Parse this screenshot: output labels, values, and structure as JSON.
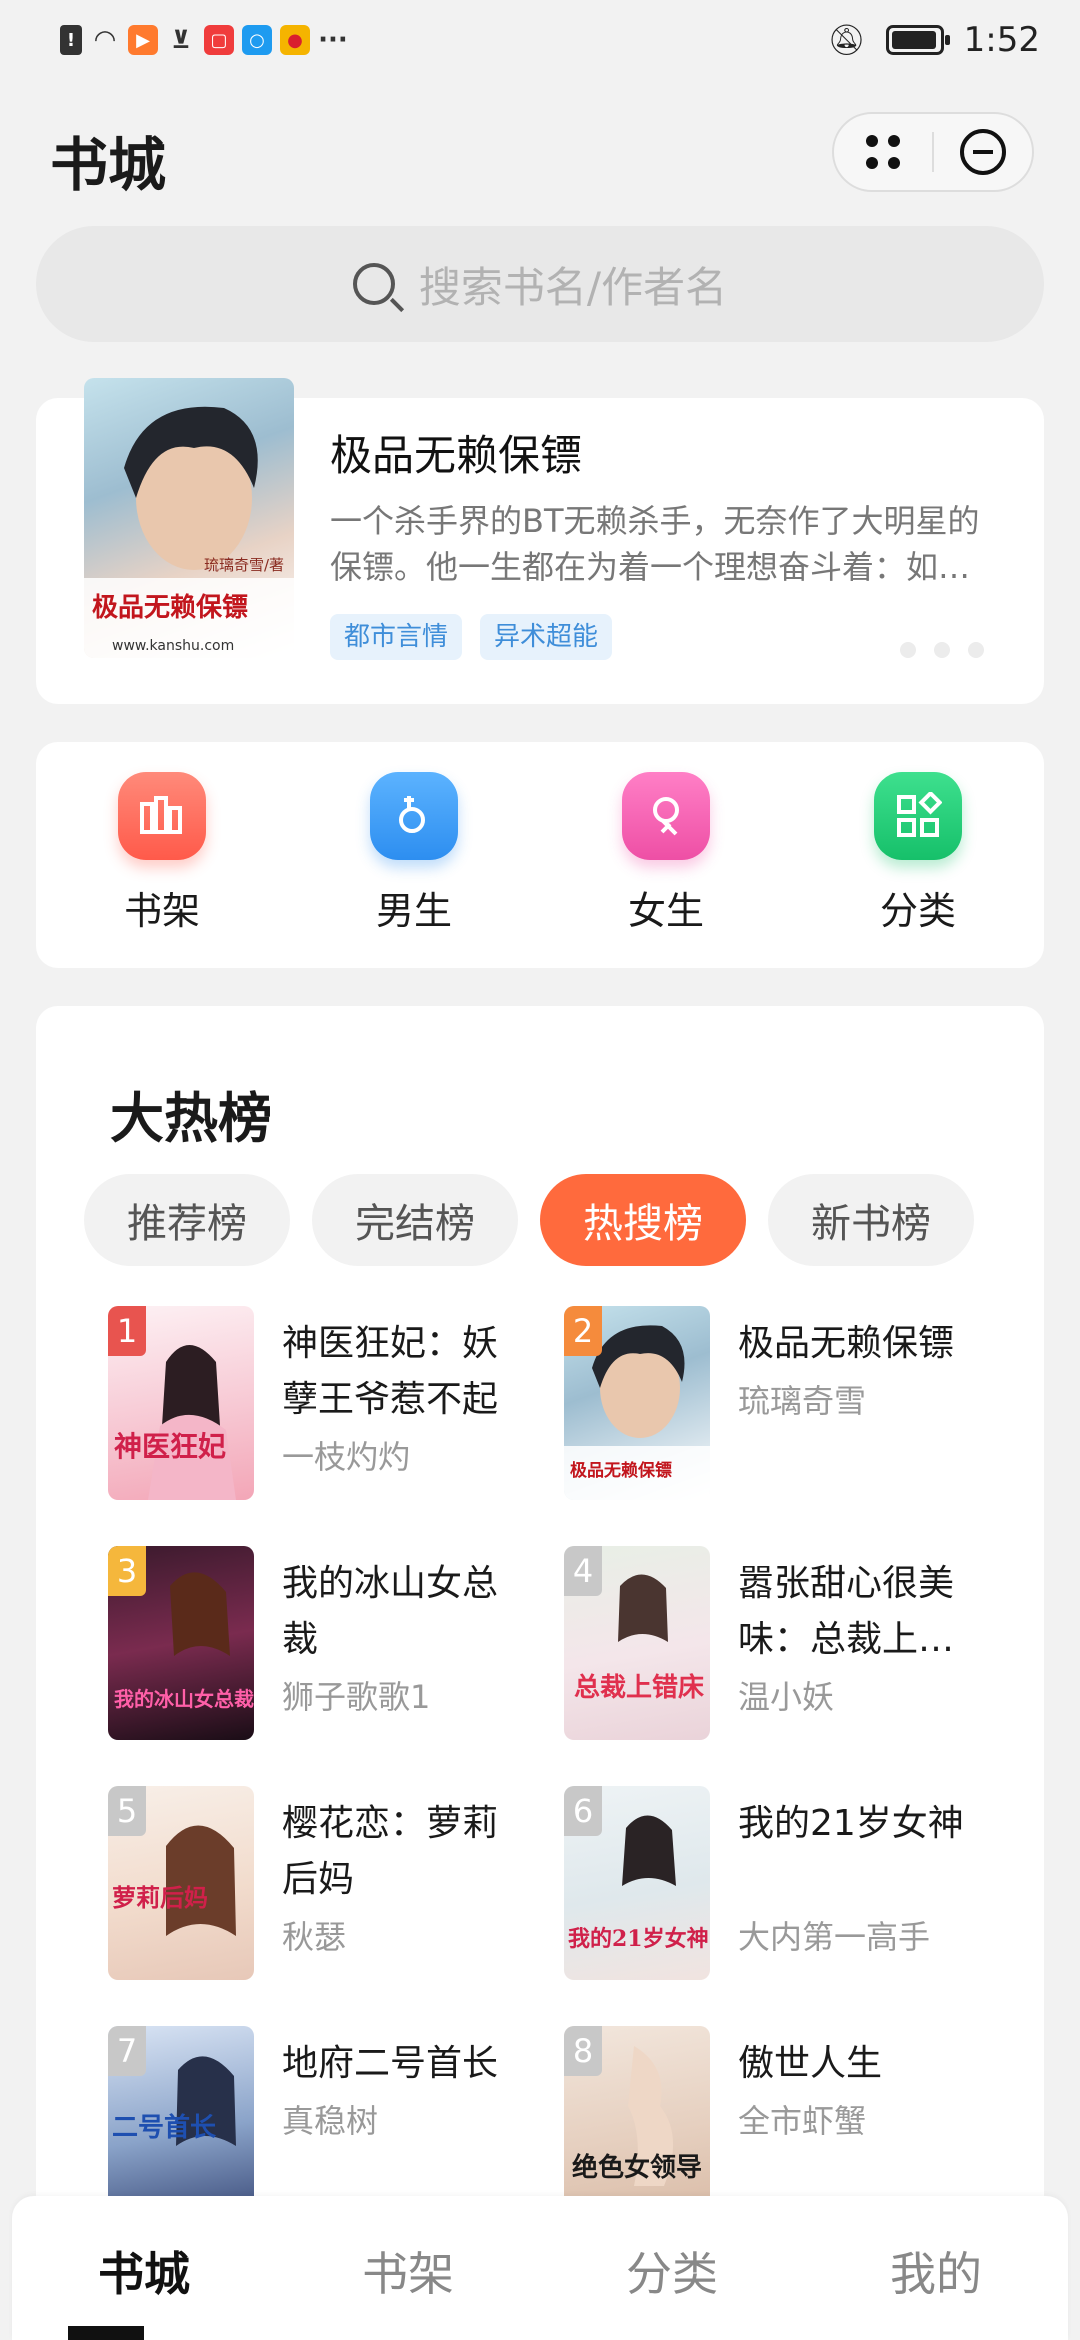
{
  "status_bar": {
    "time": "1:52",
    "icons": [
      "alert-icon",
      "wifi-icon",
      "video-app-icon",
      "cart-app-icon",
      "book-app-icon",
      "search-app-icon",
      "weibo-app-icon",
      "more-icon",
      "mute-icon",
      "battery-icon"
    ]
  },
  "header": {
    "title": "书城"
  },
  "search": {
    "placeholder": "搜索书名/作者名"
  },
  "banner": {
    "title": "极品无赖保镖",
    "description": "一个杀手界的BT无赖杀手，无奈作了大明星的保镖。他一生都在为着一个理想奋斗着：如…",
    "tags": [
      "都市言情",
      "异术超能"
    ],
    "page_dots": 3,
    "cover": {
      "author_text": "琉璃奇雪/著",
      "title_text": "极品无赖保镖",
      "site_text": "www.kanshu.com"
    }
  },
  "quick_nav": [
    {
      "label": "书架",
      "icon": "bookshelf-icon",
      "color": "#ff6b5e"
    },
    {
      "label": "男生",
      "icon": "male-icon",
      "color": "#3d9df5"
    },
    {
      "label": "女生",
      "icon": "female-icon",
      "color": "#f25fb0"
    },
    {
      "label": "分类",
      "icon": "category-icon",
      "color": "#22cc77"
    }
  ],
  "ranking": {
    "title": "大热榜",
    "tabs": [
      "推荐榜",
      "完结榜",
      "热搜榜",
      "新书榜"
    ],
    "active_tab": "热搜榜",
    "books": [
      {
        "rank": "1",
        "title": "神医狂妃：妖孽王爷惹不起",
        "author": "一枝灼灼",
        "cover_text": "神医狂妃"
      },
      {
        "rank": "2",
        "title": "极品无赖保镖",
        "author": "琉璃奇雪",
        "cover_text": "极品无赖保镖"
      },
      {
        "rank": "3",
        "title": "我的冰山女总裁",
        "author": "狮子歌歌1",
        "cover_text": "我的冰山女总裁"
      },
      {
        "rank": "4",
        "title": "嚣张甜心很美味：总裁上…",
        "author": "温小妖",
        "cover_text": "总裁上错床"
      },
      {
        "rank": "5",
        "title": "樱花恋：萝莉后妈",
        "author": "秋瑟",
        "cover_text": "萝莉后妈"
      },
      {
        "rank": "6",
        "title": "我的21岁女神",
        "author": "大内第一高手",
        "cover_text": "我的21岁女神"
      },
      {
        "rank": "7",
        "title": "地府二号首长",
        "author": "真稳树",
        "cover_text": "二号首长"
      },
      {
        "rank": "8",
        "title": "傲世人生",
        "author": "全市虾蟹",
        "cover_text": "绝色女领导"
      }
    ],
    "badge_colors": [
      "#e8544f",
      "#f58b3c",
      "#f5b73c",
      "#c8c8c8",
      "#c8c8c8",
      "#c8c8c8",
      "#c8c8c8",
      "#c8c8c8"
    ]
  },
  "tab_bar": {
    "items": [
      "书城",
      "书架",
      "分类",
      "我的"
    ],
    "active": "书城"
  }
}
